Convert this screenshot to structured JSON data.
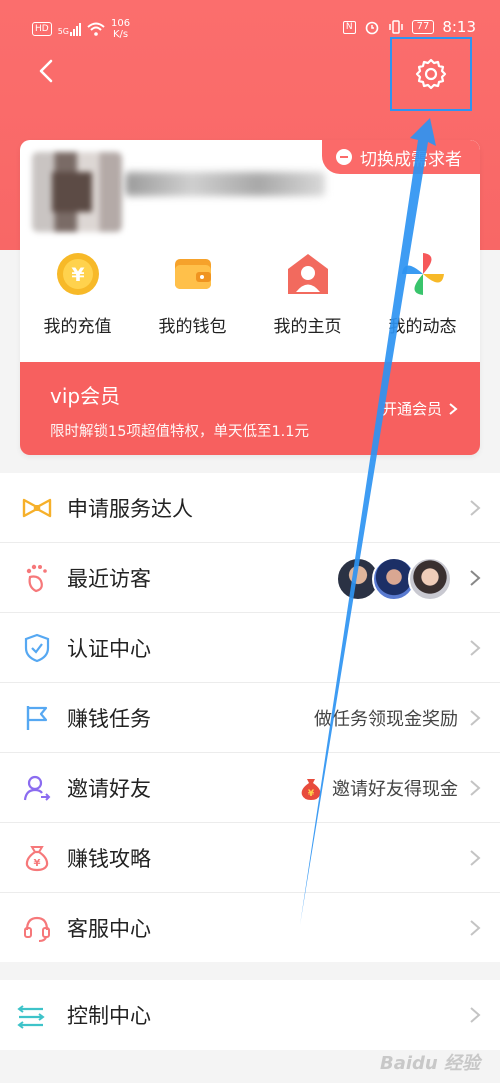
{
  "status_bar": {
    "hd": "HD",
    "signal_gen": "5G",
    "speed_value": "106",
    "speed_unit": "K/s",
    "battery": "77",
    "time": "8:13"
  },
  "header": {
    "back_icon": "chevron-left-icon",
    "settings_icon": "gear-icon"
  },
  "profile": {
    "switch_label": "切换成需求者"
  },
  "quick_actions": [
    {
      "label": "我的充值",
      "icon": "yen-coin-icon"
    },
    {
      "label": "我的钱包",
      "icon": "wallet-icon"
    },
    {
      "label": "我的主页",
      "icon": "home-user-icon"
    },
    {
      "label": "我的动态",
      "icon": "pinwheel-icon"
    }
  ],
  "vip": {
    "title": "vip会员",
    "desc": "限时解锁15项超值特权，单天低至1.1元",
    "action": "开通会员"
  },
  "menu": [
    {
      "label": "申请服务达人",
      "icon": "bowtie-icon",
      "right": ""
    },
    {
      "label": "最近访客",
      "icon": "footprint-icon",
      "right": ""
    },
    {
      "label": "认证中心",
      "icon": "shield-check-icon",
      "right": ""
    },
    {
      "label": "赚钱任务",
      "icon": "flag-icon",
      "right": "做任务领现金奖励"
    },
    {
      "label": "邀请好友",
      "icon": "add-friend-icon",
      "right": "邀请好友得现金"
    },
    {
      "label": "赚钱攻略",
      "icon": "money-bag-icon",
      "right": ""
    },
    {
      "label": "客服中心",
      "icon": "headset-icon",
      "right": ""
    }
  ],
  "menu2": {
    "label": "控制中心",
    "icon": "sliders-icon"
  },
  "watermark": "Baidu 经验",
  "colors": {
    "brand": "#fb6e6d",
    "highlight": "#2e94f2"
  }
}
